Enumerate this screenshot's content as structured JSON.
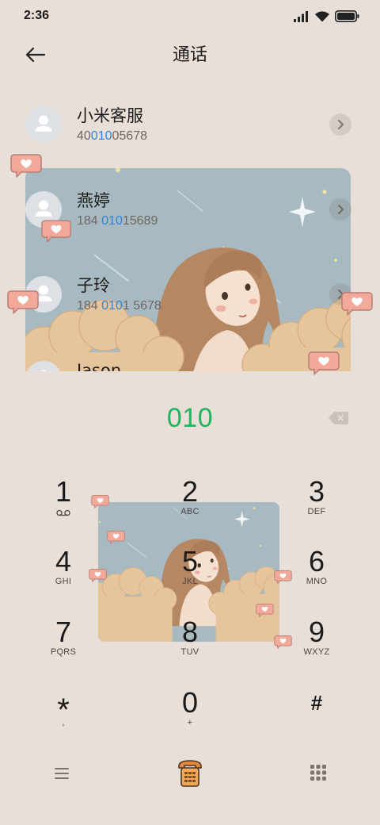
{
  "status_bar": {
    "time": "2:36",
    "signal_icon": "signal-icon",
    "wifi_icon": "wifi-icon",
    "battery_icon": "battery-icon"
  },
  "header": {
    "back_icon": "back-arrow-icon",
    "title": "通话"
  },
  "contacts": [
    {
      "name": "小米客服",
      "number_before": "40",
      "number_match": "010",
      "number_after": "05678",
      "avatar_icon": "person-icon",
      "action_icon": "chevron-right-icon"
    },
    {
      "name": "燕婷",
      "number_before": "184 ",
      "number_match": "010",
      "number_after": "15689",
      "avatar_icon": "person-icon",
      "action_icon": "chevron-right-icon"
    },
    {
      "name": "子玲",
      "number_before": "184 ",
      "number_match": "010",
      "number_after": "1 5678",
      "avatar_icon": "person-icon",
      "action_icon": "chevron-right-icon"
    },
    {
      "name": "Jason",
      "avatar_icon": "person-icon"
    }
  ],
  "dialer": {
    "input_value": "010",
    "backspace_icon": "backspace-icon"
  },
  "keypad": [
    {
      "digit": "1",
      "sub_icon": "voicemail-icon"
    },
    {
      "digit": "2",
      "letters": "ABC"
    },
    {
      "digit": "3",
      "letters": "DEF"
    },
    {
      "digit": "4",
      "letters": "GHI"
    },
    {
      "digit": "5",
      "letters": "JKL"
    },
    {
      "digit": "6",
      "letters": "MNO"
    },
    {
      "digit": "7",
      "letters": "PQRS"
    },
    {
      "digit": "8",
      "letters": "TUV"
    },
    {
      "digit": "9",
      "letters": "WXYZ"
    },
    {
      "digit": "*",
      "letters": ","
    },
    {
      "digit": "0",
      "letters": "+"
    },
    {
      "digit": "#"
    }
  ],
  "bottom_bar": {
    "menu_icon": "menu-icon",
    "call_icon": "phone-call-icon",
    "keypad_toggle_icon": "keypad-icon"
  },
  "decorations": {
    "theme_illustration": "anime-girl-sky-illustration",
    "sticker_icon": "heart-bubble-icon"
  },
  "colors": {
    "background": "#e8dfd8",
    "text": "#1f1c1b",
    "number_gray": "#6d6764",
    "match_blue": "#2e84dc",
    "dial_green": "#22b35d",
    "icon_gray": "#7b7572",
    "call_orange": "#f2aa55"
  }
}
